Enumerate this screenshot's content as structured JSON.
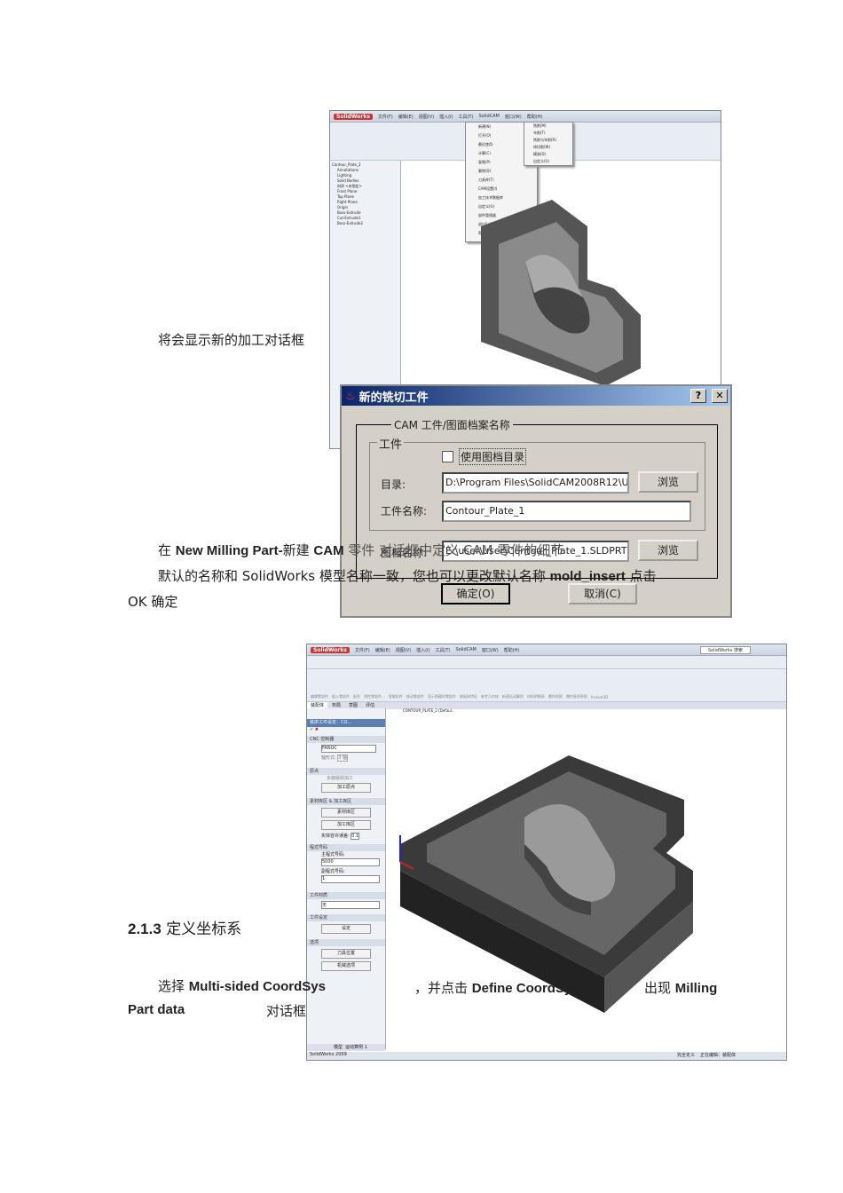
{
  "top_screenshot": {
    "app_name": "SolidWorks",
    "menu": [
      "文件(F)",
      "编辑(E)",
      "视图(V)",
      "插入(I)",
      "工具(T)",
      "SolidCAM",
      "窗口(W)",
      "帮助(H)"
    ],
    "tree_root": "Contour_Plate_2",
    "tree_items": [
      "Annotations",
      "Lighting",
      "Solid Bodies",
      "材质 <未指定>",
      "Front Plane",
      "Top Plane",
      "Right Plane",
      "Origin",
      "Boss-Extrude",
      "Cut-Extrude1",
      "Boss-Extrude2"
    ],
    "context_menu": [
      "新建(N)",
      "打开(O)",
      "最近使用",
      "计算(C)",
      "复制(P)",
      "删除(D)",
      "刀具库(T)",
      "CAM设置(I)",
      "加工技术数据库",
      "自定义(U)",
      "部件管理器",
      "退出SolidCAM",
      "帮助主题(H)"
    ],
    "submenu": [
      "铣削(M)",
      "车削(T)",
      "铣削与车削(R)",
      "线切割(W)",
      "模具(D)",
      "自定义(U)"
    ]
  },
  "dialog": {
    "title": "新的铣切工件",
    "help_label": "?",
    "close_label": "✕",
    "outer_group": "CAM 工件/图面档案名称",
    "inner_group": "工件",
    "use_dir_label": "使用图档目录",
    "use_dir_checked": false,
    "dir_label": "目录:",
    "dir_value": "D:\\Program Files\\SolidCAM2008R12\\USE",
    "part_name_label": "工件名称:",
    "part_name_value": "Contour_Plate_1",
    "model_label": "图档名称:",
    "model_value": "E:\\user\\user\\Contour_Plate_1.SLDPRT",
    "browse_label": "浏览",
    "ok_label": "确定(O)",
    "cancel_label": "取消(C)"
  },
  "text": {
    "caption1": "将会显示新的加工对话框",
    "p1_a": "在 ",
    "p1_b": "New Milling Part-",
    "p1_c": "新建 ",
    "p1_d": "CAM",
    "p1_e": " 零件 对话框中定义 CAM 零件的细节",
    "p2_a": "默认的名称和 SolidWorks 模型名称一致，您也可以更改默认名称 ",
    "p2_b": "mold_insert",
    "p2_c": " 点击",
    "p3": "OK 确定",
    "heading_num": "2.1.3",
    "heading": "定义坐标系",
    "p4_a": "选择 ",
    "p4_b": "Multi-sided CoordSys",
    "p4_c": "，并点击 ",
    "p4_d": "Define CoordSys",
    "p4_e": "出现 ",
    "p4_f": "Milling",
    "p5_a": "Part data",
    "p5_b": "对话框"
  },
  "bottom_screenshot": {
    "app_name": "SolidWorks",
    "menu": [
      "文件(F)",
      "编辑(E)",
      "视图(V)",
      "插入(I)",
      "工具(T)",
      "SolidCAM",
      "窗口(W)",
      "帮助(H)"
    ],
    "search": "SolidWorks 搜索",
    "ribbon": [
      "编辑零部件",
      "插入零部件",
      "配合",
      "线性零部件...",
      "智能扣件",
      "移动零部件",
      "显示隐藏的零部件",
      "装配体特征",
      "参考几何体",
      "新建运动算例",
      "材料明细表",
      "爆炸视图",
      "爆炸直线草图",
      "Instant3D"
    ],
    "tabs": [
      "装配体",
      "布局",
      "草图",
      "评估"
    ],
    "tree_root": "CONTOUR_PLATE_2 (Defaul...",
    "panel_title": "铣床工件设定：CO...",
    "sec_cnc": "CNC 控制器",
    "cnc_value": "FANUC",
    "axis_label": "轴形式:",
    "axis_value": "3 轴",
    "sec_origin": "原点",
    "multi_origin": "多面铣削加工",
    "origin_btn": "加工原点",
    "sec_stock": "素材库区 & 加工库区",
    "stock_btn": "素材库区",
    "target_btn": "加工库区",
    "tolerance_label": "实体容许误差:",
    "tolerance_value": "0.1",
    "sec_prog": "程式号码",
    "main_prog_label": "主程式号码:",
    "main_prog_value": "5000",
    "sub_prog_label": "副程式号码:",
    "sub_prog_value": "1",
    "sec_fixture": "工件材质",
    "fixture_value": "无",
    "sec_setup": "工件设定",
    "setup_btn": "设定",
    "sec_options": "选项",
    "tool_pos_btn": "刀具位置",
    "machine_btn": "机械选项",
    "bottom_tabs": [
      "模型",
      "运动算例 1"
    ],
    "status_left": "SolidWorks 2009",
    "status_right": [
      "完全定义",
      "正在编辑：装配体"
    ]
  }
}
